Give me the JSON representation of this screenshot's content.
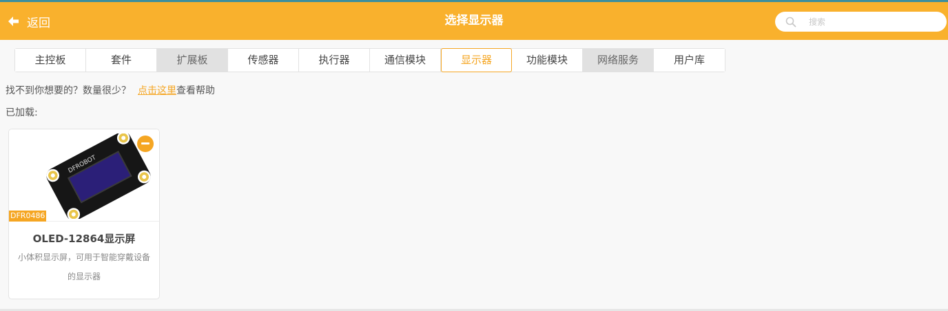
{
  "header": {
    "back_label": "返回",
    "title": "选择显示器",
    "search_placeholder": "搜索",
    "colors": {
      "bar": "#f9b12d",
      "accent": "#f5a623"
    }
  },
  "tabs": [
    {
      "label": "主控板",
      "state": "normal"
    },
    {
      "label": "套件",
      "state": "normal"
    },
    {
      "label": "扩展板",
      "state": "disabled"
    },
    {
      "label": "传感器",
      "state": "normal"
    },
    {
      "label": "执行器",
      "state": "normal"
    },
    {
      "label": "通信模块",
      "state": "normal"
    },
    {
      "label": "显示器",
      "state": "active"
    },
    {
      "label": "功能模块",
      "state": "normal"
    },
    {
      "label": "网络服务",
      "state": "disabled"
    },
    {
      "label": "用户库",
      "state": "normal"
    }
  ],
  "help": {
    "prefix": "找不到你想要的？数量很少？",
    "link": "点击这里",
    "suffix": "查看帮助"
  },
  "loaded_label": "已加载:",
  "cards": [
    {
      "sku": "DFR0486",
      "title": "OLED-12864显示屏",
      "description": "小体积显示屏，可用于智能穿戴设备的显示器",
      "image_brand_text": "DFROBOT",
      "icon": "minus-circle-icon"
    }
  ]
}
